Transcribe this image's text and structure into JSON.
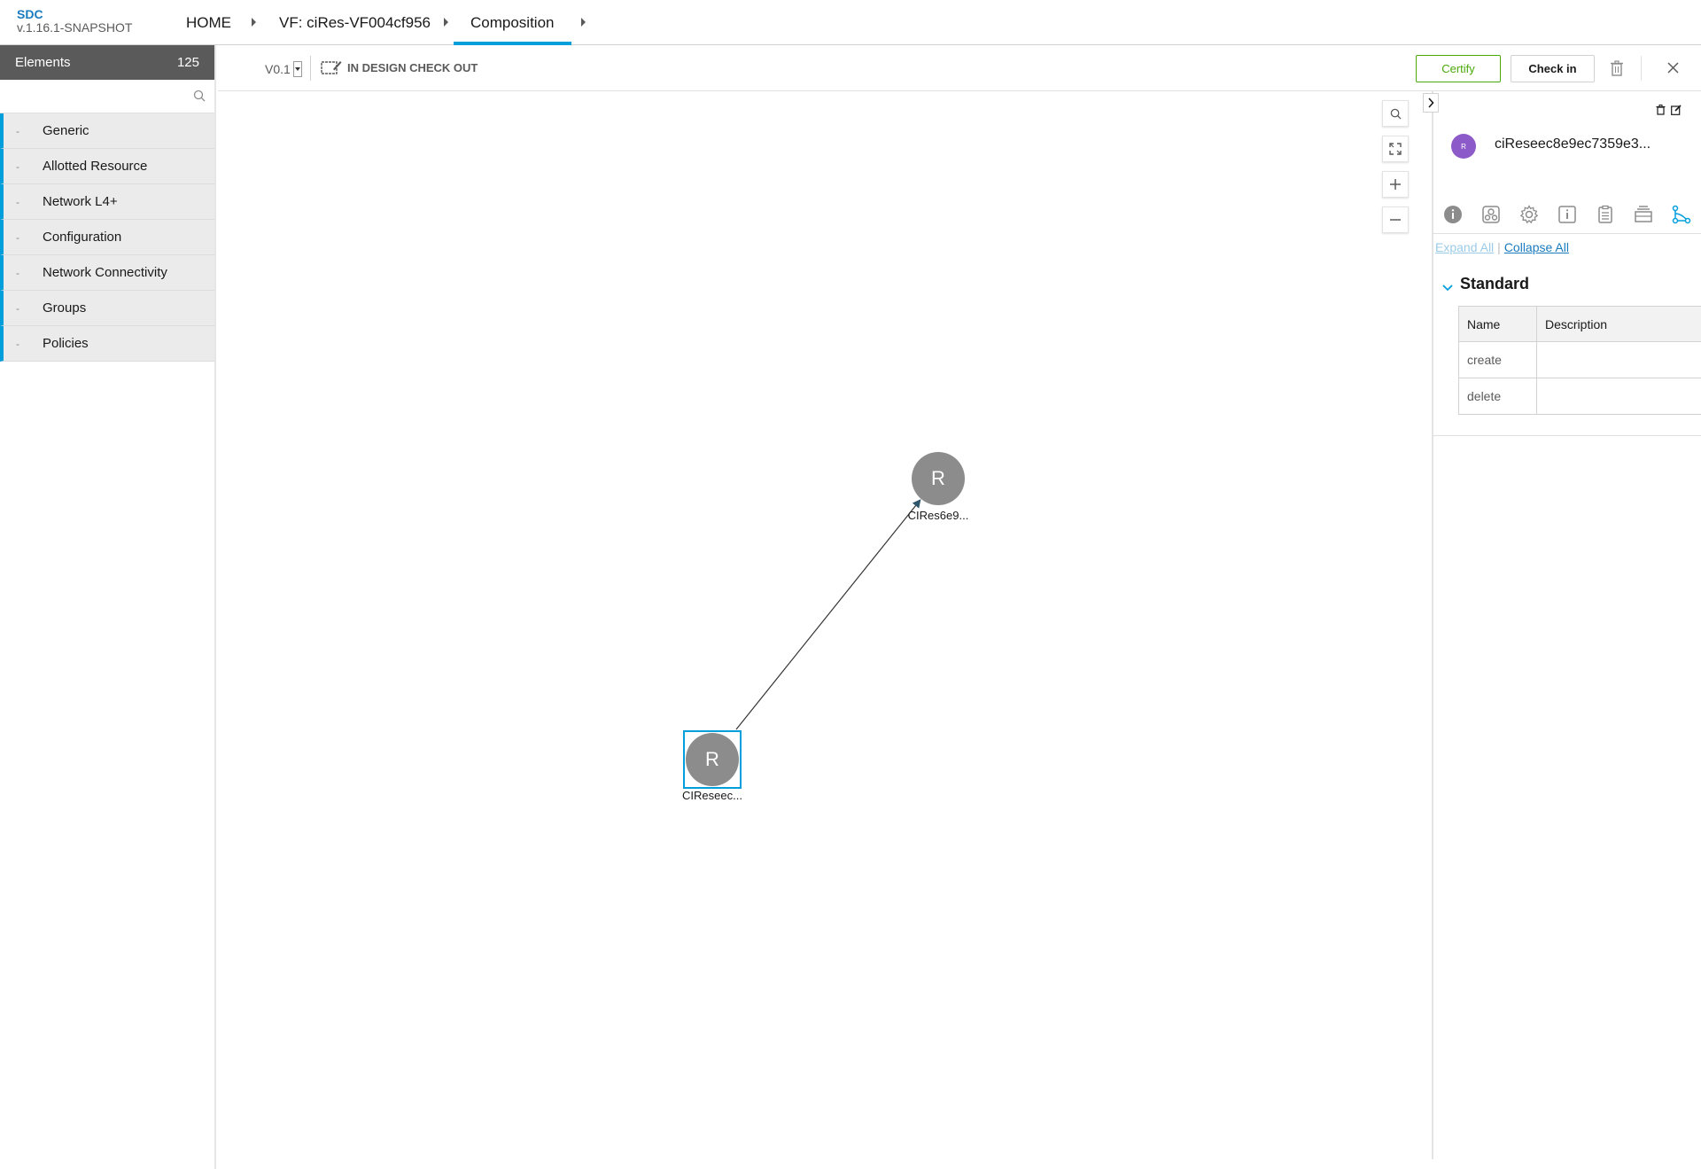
{
  "app": {
    "name": "SDC",
    "version": "v.1.16.1-SNAPSHOT"
  },
  "breadcrumb": {
    "items": [
      {
        "label": "HOME"
      },
      {
        "label": "VF: ciRes-VF004cf956"
      },
      {
        "label": "Composition"
      }
    ]
  },
  "palette": {
    "title": "Elements",
    "count": "125",
    "search_placeholder": "",
    "groups": [
      {
        "label": "Generic"
      },
      {
        "label": "Allotted Resource"
      },
      {
        "label": "Network L4+"
      },
      {
        "label": "Configuration"
      },
      {
        "label": "Network Connectivity"
      },
      {
        "label": "Groups"
      },
      {
        "label": "Policies"
      }
    ]
  },
  "toolbar": {
    "version": "V0.1",
    "status": "IN DESIGN CHECK OUT",
    "certify_label": "Certify",
    "checkin_label": "Check in"
  },
  "canvas": {
    "nodes": [
      {
        "letter": "R",
        "label": "CIRes6e9..."
      },
      {
        "letter": "R",
        "label": "CIReseec..."
      }
    ]
  },
  "right_panel": {
    "avatar_letter": "R",
    "title": "ciReseec8e9ec7359e3...",
    "expand_all": "Expand All",
    "collapse_all": "Collapse All",
    "section_title": "Standard",
    "table": {
      "headers": [
        "Name",
        "Description"
      ],
      "rows": [
        {
          "name": "create",
          "description": ""
        },
        {
          "name": "delete",
          "description": ""
        }
      ]
    }
  },
  "colors": {
    "accent": "#009fdb",
    "certify": "#4ca90c",
    "node": "#8c8c8c",
    "avatar": "#8d5ac9"
  }
}
